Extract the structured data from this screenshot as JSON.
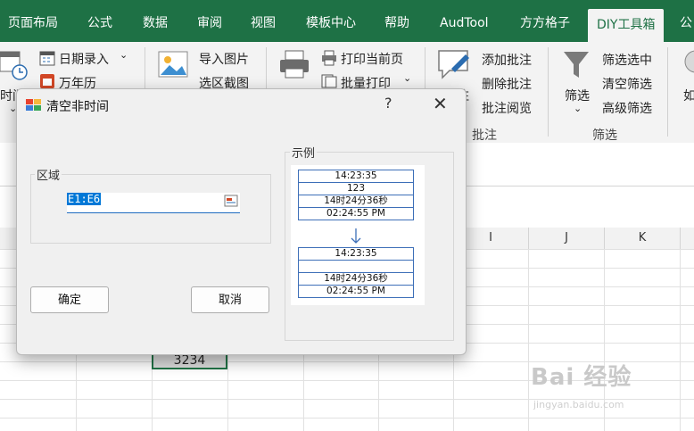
{
  "ribbon_tabs": [
    "页面布局",
    "公式",
    "数据",
    "审阅",
    "视图",
    "模板中心",
    "帮助",
    "AudTool",
    "方方格子",
    "DIY工具箱",
    "公"
  ],
  "ribbon": {
    "date_input": "日期录入",
    "calendar": "万年历",
    "time_label": "时间",
    "import_image": "导入图片",
    "region_screenshot": "选区截图",
    "print_current": "打印当前页",
    "batch_print": "批量打印",
    "add_comment": "添加批注",
    "delete_comment": "删除批注",
    "read_comment": "批注阅览",
    "comment_group": "批注",
    "comment_side": "注",
    "filter_label": "筛选",
    "filter_selected": "筛选选中",
    "clear_filter": "清空筛选",
    "advanced_filter": "高级筛选",
    "filter_group": "筛选",
    "far_right": "如"
  },
  "columns": [
    "I",
    "J",
    "K"
  ],
  "selected_cell_value": "3234",
  "dialog": {
    "title": "清空非时间",
    "help": "?",
    "close": "✕",
    "region_legend": "区域",
    "range_value": "E1:E6",
    "example_legend": "示例",
    "ok_label": "确定",
    "cancel_label": "取消",
    "example_before": [
      "14:23:35",
      "123",
      "14时24分36秒",
      "02:24:55 PM"
    ],
    "example_after": [
      "14:23:35",
      "",
      "14时24分36秒",
      "02:24:55 PM"
    ]
  },
  "watermark": "Bai 经验",
  "watermark_url": "jingyan.baidu.com"
}
